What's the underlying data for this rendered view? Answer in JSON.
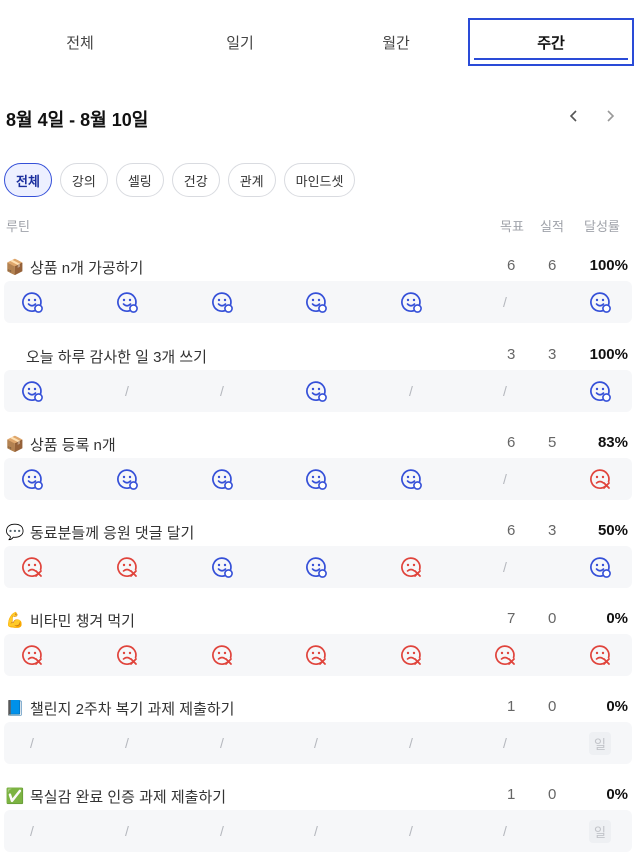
{
  "tabs": [
    {
      "label": "전체",
      "active": false
    },
    {
      "label": "일기",
      "active": false
    },
    {
      "label": "월간",
      "active": false
    },
    {
      "label": "주간",
      "active": true
    }
  ],
  "range_title": "8월 4일 - 8월 10일",
  "nav": {
    "prev_icon": "chevron-left-icon",
    "next_icon": "chevron-right-icon"
  },
  "filters": [
    {
      "label": "전체",
      "active": true
    },
    {
      "label": "강의",
      "active": false
    },
    {
      "label": "셀링",
      "active": false
    },
    {
      "label": "건강",
      "active": false
    },
    {
      "label": "관계",
      "active": false
    },
    {
      "label": "마인드셋",
      "active": false
    }
  ],
  "columns": {
    "routine": "루틴",
    "goal": "목표",
    "actual": "실적",
    "rate": "달성률"
  },
  "colors": {
    "accent": "#2a4bd7",
    "success": "#3550d8",
    "fail": "#e0443c",
    "muted": "#b5b8be"
  },
  "routines": [
    {
      "icon": "📦",
      "icon_name": "package-icon",
      "name": "상품 n개 가공하기",
      "goal": "6",
      "actual": "6",
      "rate": "100%",
      "days": [
        "ok",
        "ok",
        "ok",
        "ok",
        "ok",
        "none",
        "ok"
      ]
    },
    {
      "icon": "",
      "icon_name": "",
      "name": "오늘 하루 감사한 일 3개 쓰기",
      "goal": "3",
      "actual": "3",
      "rate": "100%",
      "days": [
        "ok",
        "none",
        "none",
        "ok",
        "none",
        "none",
        "ok"
      ]
    },
    {
      "icon": "📦",
      "icon_name": "package-icon",
      "name": "상품 등록 n개",
      "goal": "6",
      "actual": "5",
      "rate": "83%",
      "days": [
        "ok",
        "ok",
        "ok",
        "ok",
        "ok",
        "none",
        "fail"
      ]
    },
    {
      "icon": "💬",
      "icon_name": "speech-bubble-icon",
      "name": "동료분들께 응원 댓글 달기",
      "goal": "6",
      "actual": "3",
      "rate": "50%",
      "days": [
        "fail",
        "fail",
        "ok",
        "ok",
        "fail",
        "none",
        "ok"
      ]
    },
    {
      "icon": "💪",
      "icon_name": "flexed-biceps-icon",
      "name": "비타민 챙겨 먹기",
      "goal": "7",
      "actual": "0",
      "rate": "0%",
      "days": [
        "fail",
        "fail",
        "fail",
        "fail",
        "fail",
        "fail",
        "fail"
      ]
    },
    {
      "icon": "📘",
      "icon_name": "blue-book-icon",
      "name": "챌린지 2주차 복기 과제 제출하기",
      "goal": "1",
      "actual": "0",
      "rate": "0%",
      "days": [
        "none",
        "none",
        "none",
        "none",
        "none",
        "none",
        "label"
      ],
      "day_label": "일"
    },
    {
      "icon": "✅",
      "icon_name": "check-box-icon",
      "name": "목실감 완료 인증 과제 제출하기",
      "goal": "1",
      "actual": "0",
      "rate": "0%",
      "days": [
        "none",
        "none",
        "none",
        "none",
        "none",
        "none",
        "label"
      ],
      "day_label": "일"
    }
  ]
}
